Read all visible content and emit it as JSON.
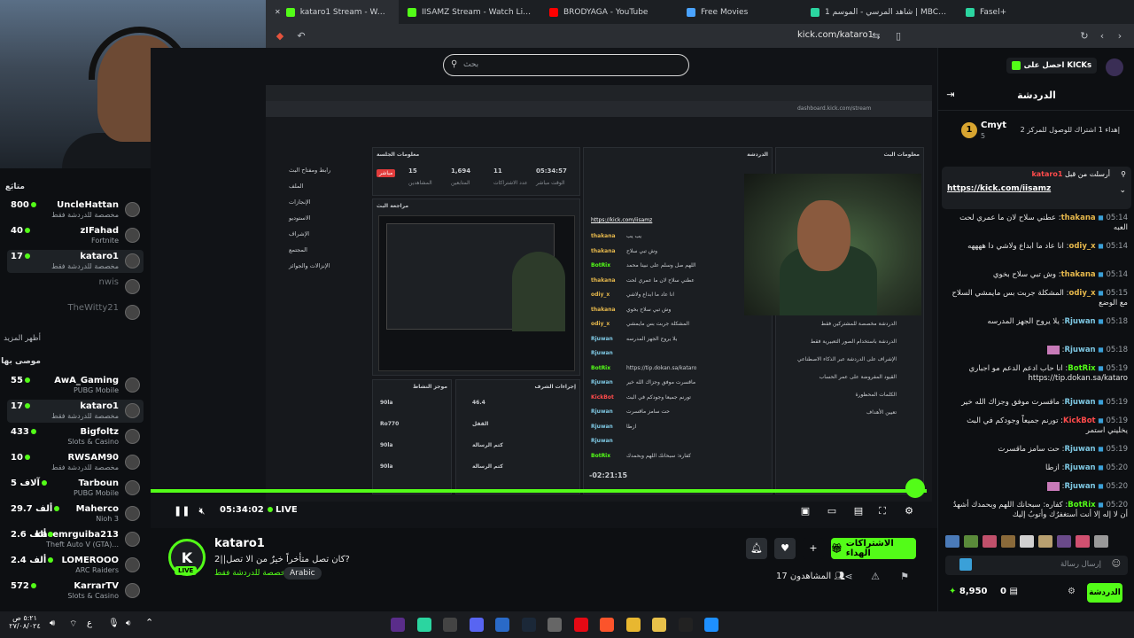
{
  "browser": {
    "tabs": [
      {
        "label": "kataro1 Stream - Watch Live on",
        "active": true
      },
      {
        "label": "IISAMZ Stream - Watch Live on K",
        "active": false
      },
      {
        "label": "BRODYAGA - YouTube",
        "active": false
      },
      {
        "label": "Free Movies",
        "active": false
      },
      {
        "label": "شاهد المرسي - الموسم 1 | MBC شاهد",
        "active": false
      },
      {
        "label": "Fasel+",
        "active": false
      }
    ],
    "url": "kick.com/kataro1"
  },
  "search": {
    "placeholder": "بحث"
  },
  "leftbar": {
    "following_label": "متابَع",
    "following": [
      {
        "name": "UncleHattan",
        "count": "800",
        "sub": "مخصصة للدردشة فقط"
      },
      {
        "name": "zIFahad",
        "count": "40",
        "sub": "Fortnite"
      },
      {
        "name": "kataro1",
        "count": "17",
        "sub": "مخصصة للدردشة فقط"
      },
      {
        "name": "nwis",
        "count": "",
        "sub": ""
      },
      {
        "name": "TheWitty21",
        "count": "",
        "sub": ""
      }
    ],
    "show_more": "أظهر المزيد",
    "recommended_label": "موصى بها",
    "recommended": [
      {
        "name": "AwA_Gaming",
        "count": "55",
        "sub": "PUBG Mobile"
      },
      {
        "name": "kataro1",
        "count": "17",
        "sub": "مخصصة للدردشة فقط"
      },
      {
        "name": "Bigfoltz",
        "count": "433",
        "sub": "Slots & Casino"
      },
      {
        "name": "RWSAM90",
        "count": "10",
        "sub": "مخصصة للدردشة فقط"
      },
      {
        "name": "Tarboun",
        "count": "5 آلاف",
        "sub": "PUBG Mobile"
      },
      {
        "name": "Maherco",
        "count": "29.7 ألف",
        "sub": "Nioh 3"
      },
      {
        "name": "kacemrguiba213",
        "count": "2.6 ألف",
        "sub": "Theft Auto V (GTA)..."
      },
      {
        "name": "LOMEROOO",
        "count": "2.4 ألف",
        "sub": "ARC Raiders"
      },
      {
        "name": "KarrarTV",
        "count": "572",
        "sub": "Slots & Casino"
      }
    ]
  },
  "inner": {
    "url": "dashboard.kick.com/stream",
    "session_label": "معلومات الجلسة",
    "stats": [
      {
        "value": "05:34:57",
        "label": "الوقت مباشر"
      },
      {
        "value": "11",
        "label": "عدد الاشتراكات"
      },
      {
        "value": "1,694",
        "label": "المتابعين"
      },
      {
        "value": "15",
        "label": "المشاهدين"
      }
    ],
    "live_badge": "مباشر",
    "preview_label": "مراجعة البث",
    "chat_label": "الدردشة",
    "stream_info": "معلومات البث",
    "menu": [
      "رابط ومفتاح البث",
      "الملف",
      "الإنجازات",
      "الاستوديو",
      "الإشراف",
      "المجتمع",
      "الإنزالات والجوائز"
    ],
    "mod_actions_label": "إجراءات الشرف",
    "recent_label": "موجز النشاط",
    "activity": [
      "90la",
      "Ro770",
      "90la",
      "90la"
    ],
    "actions": [
      "46.4",
      "القفل",
      "كتم الرسالة",
      "كتم الرسالة"
    ],
    "timer": "-02:21:15",
    "inner_pinned": "https://kick.com/iisamz",
    "inner_chat": [
      {
        "user": "thakana",
        "text": "يب يب"
      },
      {
        "user": "thakana",
        "text": "وش تبي سلاح"
      },
      {
        "user": "BotRix",
        "text": "اللهم صل وسلم على نبينا محمد"
      },
      {
        "user": "thakana",
        "text": "عطني سلاح لان ما عمري لحت"
      },
      {
        "user": "odiy_x",
        "text": "انا عاد ما ابداع ولاشي"
      },
      {
        "user": "thakana",
        "text": "وش تبي سلاح بخوي"
      },
      {
        "user": "odiy_x",
        "text": "المشكلة جربت بس مايمشي"
      },
      {
        "user": "Rjuwan",
        "text": "يلا يروح الجهز المدرسه"
      },
      {
        "user": "Rjuwan",
        "text": ""
      },
      {
        "user": "BotRix",
        "text": "https://tip.dokan.sa/kataro"
      },
      {
        "user": "Rjuwan",
        "text": "ماقسرت موفق وجزاك الله خير"
      },
      {
        "user": "KickBot",
        "text": "تورنم جميعاً وجودكم في البث"
      },
      {
        "user": "Rjuwan",
        "text": "حت سامز ماقسرت"
      },
      {
        "user": "Rjuwan",
        "text": "ازطا"
      },
      {
        "user": "Rjuwan",
        "text": ""
      },
      {
        "user": "BotRix",
        "text": "كفاره: سبحانك اللهم وبحمدك"
      }
    ],
    "settings": [
      "الدردشة مخصصة للمشتركين فقط",
      "الدردشة باستخدام الصور التعبيرية فقط",
      "الإشراف على الدردشة عبر الذكاء الاصطناعي",
      "القيود المفروضة على عمر الحساب",
      "الكلمات المحظورة",
      "تعيين الأهداف"
    ]
  },
  "player": {
    "elapsed": "05:34:02",
    "live_label": "LIVE",
    "progress": 0.99
  },
  "streamer": {
    "name": "kataro1",
    "avatar_letter": "K",
    "live_badge": "LIVE",
    "title": "كان تصل متأخراً خيرٌ من الا تصل||2?",
    "category": "مخصصة للدردشة فقط",
    "tag": "Arabic",
    "subscribe_label": "الاشتراكات الهداء",
    "viewers_label": "المشاهدون",
    "viewers": "17"
  },
  "chat": {
    "get_kicks": "احصل على KICKs",
    "title": "الدردشة",
    "top_user": "Cmyt",
    "top_rank": "1",
    "top_count": "5",
    "top_note": "إهداء 1 اشتراك للوصول للمركز 2",
    "pinned_by": "أرسلت من قبل",
    "pinned_user": "kataro1",
    "pinned_link": "https://kick.com/iisamz",
    "messages": [
      {
        "time": "05:14",
        "user": "thakana",
        "color": "#e6b84c",
        "text": "عطني سلاح لان ما عمري لحت العبه"
      },
      {
        "time": "05:14",
        "user": "odiy_x",
        "color": "#e6b84c",
        "text": "انا عاد ما ابداع ولاشي دا ههههه"
      },
      {
        "time": "05:14",
        "user": "thakana",
        "color": "#e6b84c",
        "text": "وش تبي سلاح بخوي"
      },
      {
        "time": "05:15",
        "user": "odiy_x",
        "color": "#e6b84c",
        "text": "المشكلة جربت بس مايمشي السلاح مع الوضع"
      },
      {
        "time": "05:18",
        "user": "Rjuwan",
        "color": "#7ec8e3",
        "text": "يلا يروح الجهز المدرسه"
      },
      {
        "time": "05:18",
        "user": "Rjuwan",
        "color": "#7ec8e3",
        "text": ""
      },
      {
        "time": "05:19",
        "user": "BotRix",
        "color": "#53fc18",
        "text": "انا حاب ادعم الدعم مو اجباري https://tip.dokan.sa/kataro"
      },
      {
        "time": "05:19",
        "user": "Rjuwan",
        "color": "#7ec8e3",
        "text": "ماقسرت موفق وجزاك الله خير"
      },
      {
        "time": "05:19",
        "user": "KickBot",
        "color": "#ff4b4b",
        "text": "تورنم جميعاً وجودكم في البث يخليني استمر"
      },
      {
        "time": "05:19",
        "user": "Rjuwan",
        "color": "#7ec8e3",
        "text": "حت سامز ماقسرت"
      },
      {
        "time": "05:20",
        "user": "Rjuwan",
        "color": "#7ec8e3",
        "text": "ازطا"
      },
      {
        "time": "05:20",
        "user": "Rjuwan",
        "color": "#7ec8e3",
        "text": ""
      },
      {
        "time": "05:20",
        "user": "BotRix",
        "color": "#53fc18",
        "text": "كفاره: سبحانك اللهم وبحمدك أشهدُ أن لا إله إلا أنت أستغفرُك وأتوبُ إليك"
      }
    ],
    "input_placeholder": "إرسال رسالة",
    "points": "8,950",
    "kicks": "0",
    "send_label": "الدردشة"
  },
  "taskbar": {
    "clock_time": "٥:٢١ ص",
    "clock_date": "٢٧/٠٨/٠٢٤",
    "lang": "ع"
  },
  "colors": {
    "accent": "#53fc18",
    "bg": "#0b0d10"
  }
}
